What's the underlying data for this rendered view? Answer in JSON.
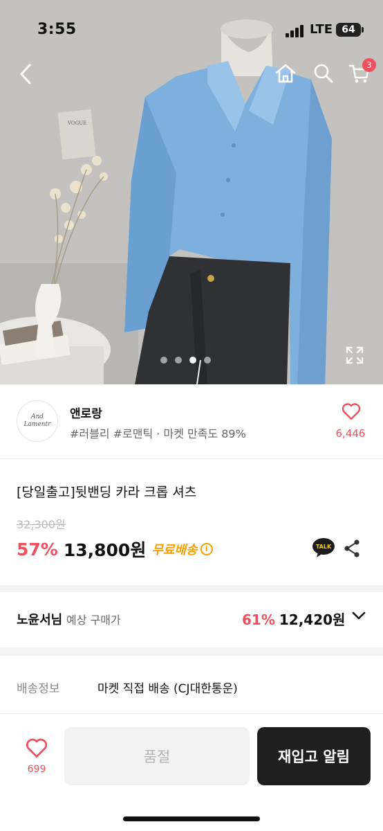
{
  "status_bar": {
    "time": "3:55",
    "network": "LTE",
    "battery": "64"
  },
  "header": {
    "cart_count": "3"
  },
  "gallery": {
    "pages": 4,
    "active_page": 3
  },
  "shop": {
    "logo_text": "And Lamentr",
    "name": "앤로랑",
    "tags": "#러블리 #로맨틱 · 마켓 만족도 89%",
    "like_count": "6,446"
  },
  "product": {
    "title": "[당일출고]뒷밴딩 카라 크롭 셔츠",
    "original_price": "32,300원",
    "discount": "57%",
    "sale_price": "13,800원",
    "free_shipping": "무료배송",
    "talk_label": "TALK"
  },
  "member": {
    "name": "노윤서님",
    "label_suffix": "예상 구매가",
    "discount": "61%",
    "price": "12,420원"
  },
  "delivery": {
    "label": "배송정보",
    "value": "마켓 직접 배송 (CJ대한통운)"
  },
  "bottom_bar": {
    "like_count": "699",
    "soldout_label": "품절",
    "restock_label": "재입고 알림"
  },
  "colors": {
    "accent": "#f04f5d",
    "shipping": "#f5a000",
    "dark_button": "#1f1f1f"
  }
}
